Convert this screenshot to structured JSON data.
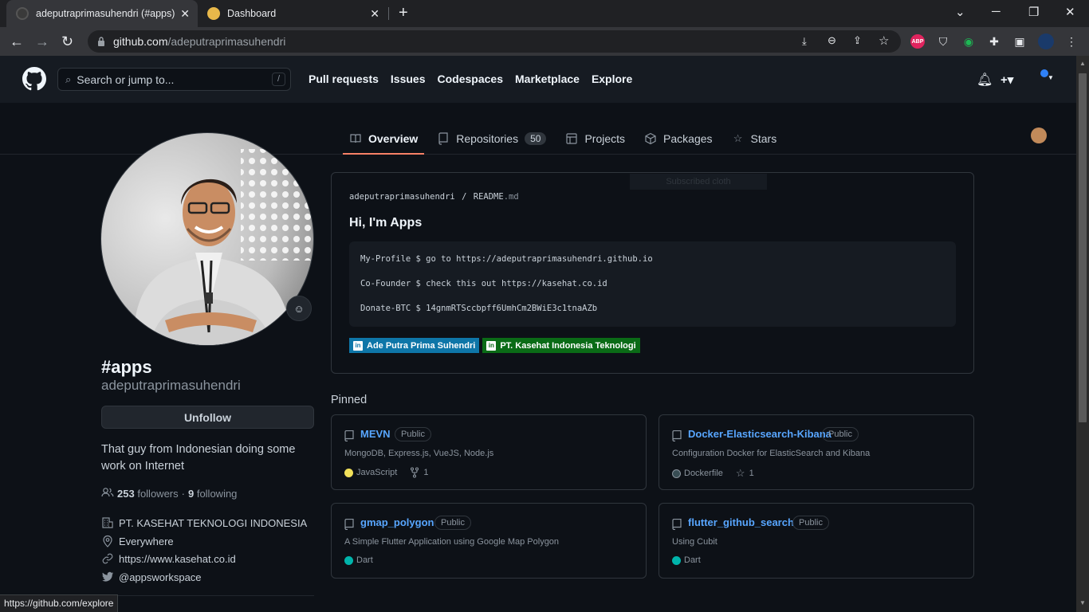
{
  "browser": {
    "tabs": [
      {
        "title": "adeputraprimasuhendri (#apps)",
        "active": true
      },
      {
        "title": "Dashboard",
        "active": false
      }
    ],
    "address": {
      "host": "github.com",
      "path": "/adeputraprimasuhendri"
    },
    "status_url": "https://github.com/explore",
    "extensions": [
      "abp-icon",
      "shield-icon",
      "vpn-icon",
      "puzzle-icon"
    ],
    "abp_label": "ABP"
  },
  "header": {
    "search_placeholder": "Search or jump to...",
    "search_key": "/",
    "nav": [
      "Pull requests",
      "Issues",
      "Codespaces",
      "Marketplace",
      "Explore"
    ],
    "plus_label": "+▾"
  },
  "profile_tabs": [
    {
      "label": "Overview",
      "active": true
    },
    {
      "label": "Repositories",
      "count": "50"
    },
    {
      "label": "Projects"
    },
    {
      "label": "Packages"
    },
    {
      "label": "Stars"
    }
  ],
  "profile": {
    "name": "#apps",
    "login": "adeputraprimasuhendri",
    "follow_button": "Unfollow",
    "bio": "That guy from Indonesian doing some work on Internet",
    "followers": "253",
    "followers_label": "followers",
    "separator": "·",
    "following": "9",
    "following_label": "following",
    "company": "PT. KASEHAT TEKNOLOGI INDONESIA",
    "location": "Everywhere",
    "website": "https://www.kasehat.co.id",
    "twitter": "@appsworkspace"
  },
  "readme": {
    "owner": "adeputraprimasuhendri",
    "sep": "/",
    "file": "README",
    "ext": ".md",
    "title": "Hi, I'm Apps",
    "ghost_text": "Subscribed cloth",
    "code_lines": [
      "My-Profile $ go to https://adeputraprimasuhendri.github.io",
      "Co-Founder $ check this out https://kasehat.co.id",
      "Donate-BTC $ 14gnmRTSccbpff6UmhCm2BWiE3c1tnaAZb"
    ],
    "badges": [
      {
        "text": "Ade Putra Prima Suhendri",
        "color": "#0e76a8"
      },
      {
        "text": "PT. Kasehat Indonesia Teknologi",
        "color": "#0a6b16"
      }
    ]
  },
  "pinned": {
    "heading": "Pinned",
    "repos": [
      {
        "name": "MEVN",
        "visibility": "Public",
        "description": "MongoDB, Express.js, VueJS, Node.js",
        "language": "JavaScript",
        "lang_color": "#f1e05a",
        "stat_icon": "fork-icon",
        "stat": "1"
      },
      {
        "name": "Docker-Elasticsearch-Kibana",
        "visibility": "Public",
        "description": "Configuration Docker for ElasticSearch and Kibana",
        "language": "Dockerfile",
        "lang_color": "#384d54",
        "stat_icon": "star-icon",
        "stat": "1"
      },
      {
        "name": "gmap_polygon",
        "visibility": "Public",
        "description": "A Simple Flutter Application using Google Map Polygon",
        "language": "Dart",
        "lang_color": "#00b4ab"
      },
      {
        "name": "flutter_github_search",
        "visibility": "Public",
        "description": "Using Cubit",
        "language": "Dart",
        "lang_color": "#00b4ab"
      }
    ]
  }
}
